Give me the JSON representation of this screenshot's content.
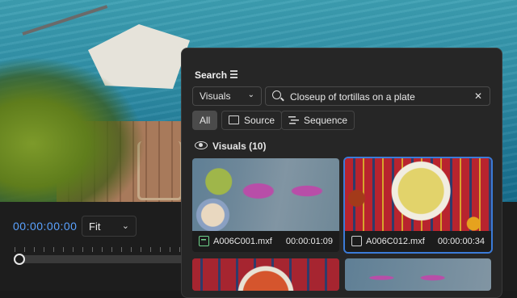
{
  "program": {
    "timecode": "00:00:00:00",
    "fit_label": "Fit"
  },
  "search_panel": {
    "title": "Search",
    "scope_select": "Visuals",
    "query": "Closeup of tortillas on a plate",
    "filters": [
      {
        "label": "All",
        "active": true
      },
      {
        "label": "Source",
        "active": false
      },
      {
        "label": "Sequence",
        "active": false
      }
    ],
    "section_header": "Visuals (10)",
    "results": [
      {
        "filename": "A006C001.mxf",
        "duration": "00:00:01:09",
        "selected": false
      },
      {
        "filename": "A006C012.mxf",
        "duration": "00:00:00:34",
        "selected": true
      }
    ]
  },
  "colors": {
    "timecode": "#5aa2ff",
    "selection_outline": "#3b7bd8",
    "panel_bg": "#262626"
  },
  "icons": [
    "menu-icon",
    "chevron-down-icon",
    "search-icon",
    "clear-icon",
    "source-icon",
    "sequence-icon",
    "eye-icon",
    "multicam-clip-icon",
    "clip-icon"
  ]
}
